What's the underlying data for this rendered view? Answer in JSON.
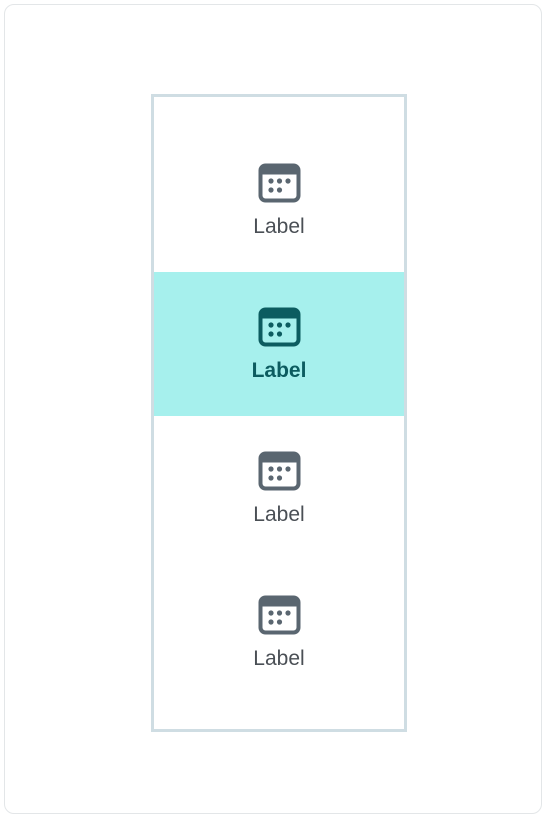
{
  "nav": {
    "items": [
      {
        "label": "Label",
        "icon": "calendar-icon",
        "selected": false
      },
      {
        "label": "Label",
        "icon": "calendar-icon",
        "selected": true
      },
      {
        "label": "Label",
        "icon": "calendar-icon",
        "selected": false
      },
      {
        "label": "Label",
        "icon": "calendar-icon",
        "selected": false
      }
    ]
  },
  "colors": {
    "selected_background": "#a6f0ed",
    "selected_foreground": "#0c5c60",
    "default_icon": "#5a6670",
    "default_text": "#4a4f55",
    "rail_border": "#cfdde3"
  }
}
